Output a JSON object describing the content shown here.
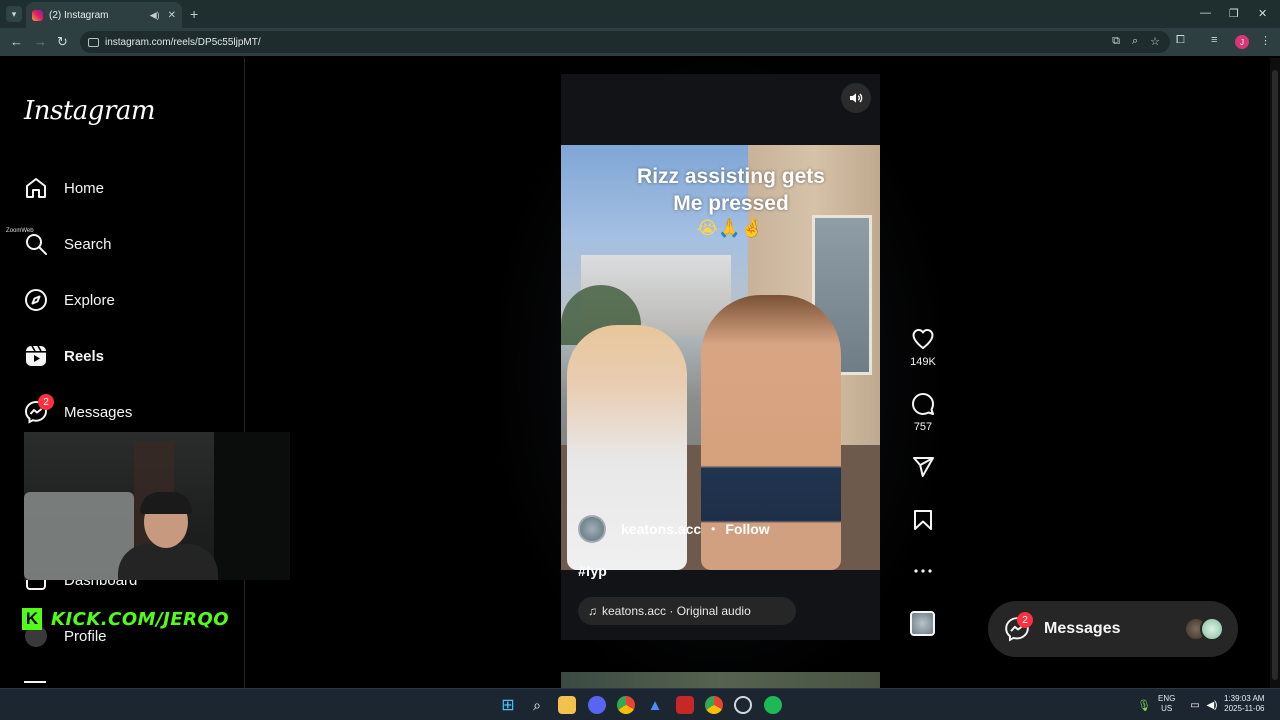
{
  "browser": {
    "tab_title": "(2) Instagram",
    "url": "instagram.com/reels/DP5c55ljpMT/"
  },
  "sidebar": {
    "logo": "Instagram",
    "items": [
      {
        "label": "Home",
        "icon": "home-icon"
      },
      {
        "label": "Search",
        "icon": "search-icon"
      },
      {
        "label": "Explore",
        "icon": "compass-icon"
      },
      {
        "label": "Reels",
        "icon": "reels-icon",
        "active": true
      },
      {
        "label": "Messages",
        "icon": "messenger-icon",
        "badge": "2"
      },
      {
        "label": "Dashboard",
        "icon": "dashboard-icon"
      },
      {
        "label": "Profile",
        "icon": "profile-icon"
      }
    ]
  },
  "overlay": {
    "stream_link": "KICK.COM/JERQO",
    "zoom_label": "ZoomWeb"
  },
  "reel": {
    "caption_line1": "Rizz assisting gets",
    "caption_line2": "Me pressed",
    "caption_emojis": "😭🙏🤞",
    "author": "keatons.acc",
    "follow_label": "Follow",
    "hashtag": "#fyp",
    "audio": "keatons.acc · Original audio"
  },
  "actions": {
    "likes": "149K",
    "comments": "757"
  },
  "messages_pill": {
    "label": "Messages",
    "badge": "2"
  },
  "taskbar": {
    "lang_line1": "ENG",
    "lang_line2": "US",
    "time": "1:39:03 AM",
    "date": "2025-11-06"
  },
  "colors": {
    "background": "#000000",
    "notification_badge": "#ff3040",
    "kick_green": "#53fc18",
    "browser_chrome": "#2d3f40"
  }
}
